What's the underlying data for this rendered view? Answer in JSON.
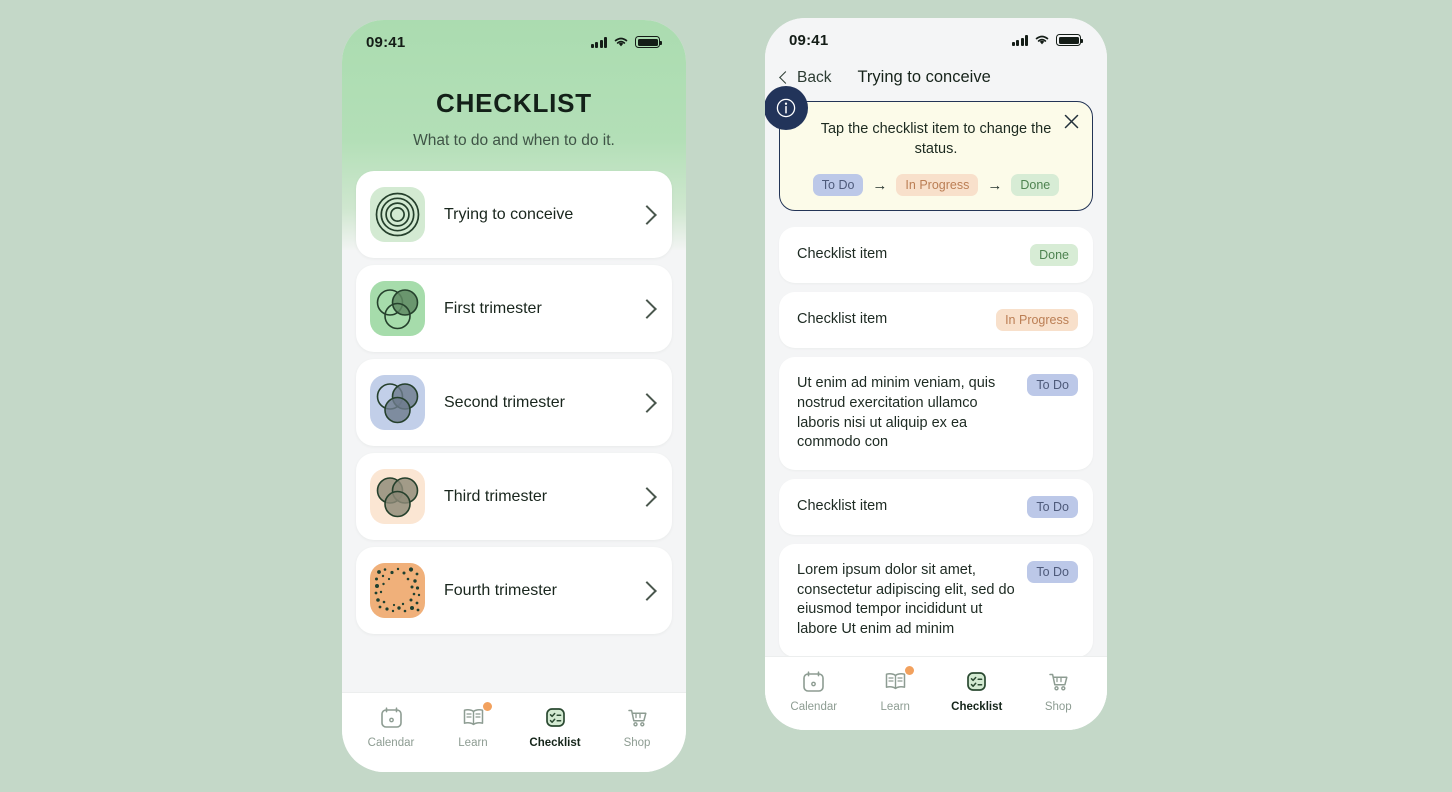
{
  "page": {
    "background": "#c4d8c8"
  },
  "colors": {
    "header_green": "#abdcb0",
    "card_white": "#ffffff",
    "body_gray": "#f4f5f6",
    "banner_bg": "#fcfbe9",
    "banner_border": "#233456",
    "pill_todo_bg": "#bcc8e8",
    "pill_inprogress_bg": "#f8e0cb",
    "pill_done_bg": "#d7ecd5",
    "badge_orange": "#f2a15e"
  },
  "left_phone": {
    "status_bar": {
      "time": "09:41",
      "signal_icon": "cellular-signal-icon",
      "wifi_icon": "wifi-icon",
      "battery_icon": "battery-icon"
    },
    "title": "CHECKLIST",
    "subtitle": "What to do and when to do it.",
    "categories": [
      {
        "label": "Trying to conceive",
        "icon": "concentric-circles-icon",
        "icon_bg": "#d3ead2",
        "chevron": "chevron-right-icon"
      },
      {
        "label": "First trimester",
        "icon": "venn-one-filled-icon",
        "icon_bg": "#a6dcab",
        "chevron": "chevron-right-icon"
      },
      {
        "label": "Second trimester",
        "icon": "venn-two-filled-icon",
        "icon_bg": "#c2cfe9",
        "chevron": "chevron-right-icon"
      },
      {
        "label": "Third trimester",
        "icon": "venn-three-filled-icon",
        "icon_bg": "#fbe6d3",
        "chevron": "chevron-right-icon"
      },
      {
        "label": "Fourth trimester",
        "icon": "scattered-dots-icon",
        "icon_bg": "#f0b07a",
        "chevron": "chevron-right-icon"
      }
    ],
    "tabs": [
      {
        "label": "Calendar",
        "icon": "calendar-icon",
        "active": false,
        "badge": false
      },
      {
        "label": "Learn",
        "icon": "book-icon",
        "active": false,
        "badge": true
      },
      {
        "label": "Checklist",
        "icon": "checklist-icon",
        "active": true,
        "badge": false
      },
      {
        "label": "Shop",
        "icon": "cart-icon",
        "active": false,
        "badge": false
      }
    ]
  },
  "right_phone": {
    "status_bar": {
      "time": "09:41",
      "signal_icon": "cellular-signal-icon",
      "wifi_icon": "wifi-icon",
      "battery_icon": "battery-icon"
    },
    "back_label": "Back",
    "screen_title": "Trying to conceive",
    "banner": {
      "icon": "info-circle-icon",
      "close_icon": "close-x-icon",
      "message": "Tap the checklist item to change the status.",
      "flow": [
        {
          "label": "To Do",
          "style": "todo"
        },
        {
          "label": "In Progress",
          "style": "prog"
        },
        {
          "label": "Done",
          "style": "done"
        }
      ],
      "arrow": "→"
    },
    "items": [
      {
        "text": "Checklist item",
        "status": "Done",
        "style": "done",
        "multiline": false
      },
      {
        "text": "Checklist item",
        "status": "In Progress",
        "style": "prog",
        "multiline": false
      },
      {
        "text": "Ut enim ad minim veniam, quis nostrud exercitation ullamco laboris nisi ut aliquip ex ea commodo con",
        "status": "To Do",
        "style": "todo",
        "multiline": true
      },
      {
        "text": "Checklist item",
        "status": "To Do",
        "style": "todo",
        "multiline": false
      },
      {
        "text": "Lorem ipsum dolor sit amet, consectetur adipiscing elit, sed do eiusmod tempor incididunt ut labore Ut enim ad minim",
        "status": "To Do",
        "style": "todo",
        "multiline": true
      }
    ],
    "tabs": [
      {
        "label": "Calendar",
        "icon": "calendar-icon",
        "active": false,
        "badge": false
      },
      {
        "label": "Learn",
        "icon": "book-icon",
        "active": false,
        "badge": true
      },
      {
        "label": "Checklist",
        "icon": "checklist-icon",
        "active": true,
        "badge": false
      },
      {
        "label": "Shop",
        "icon": "cart-icon",
        "active": false,
        "badge": false
      }
    ]
  }
}
